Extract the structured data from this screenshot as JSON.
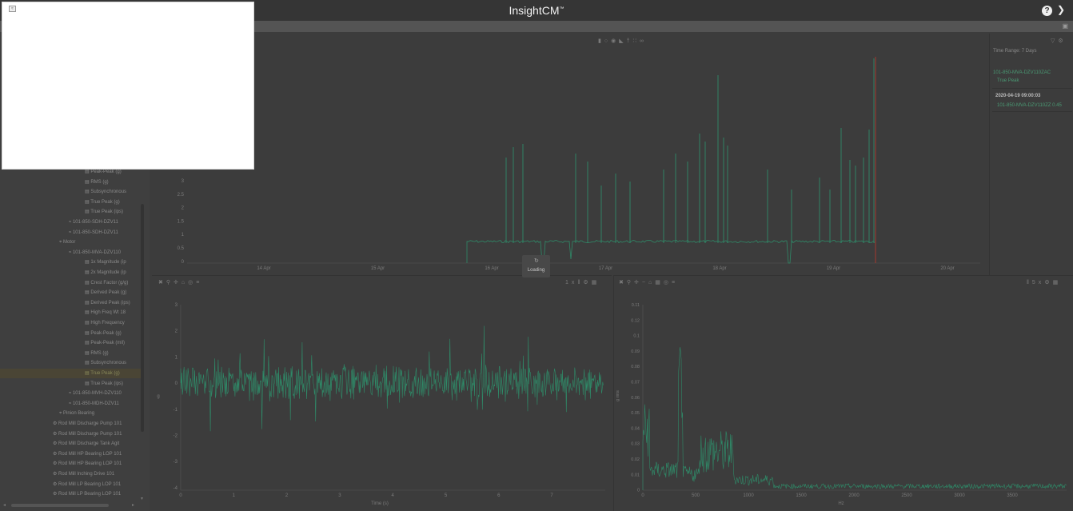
{
  "app": {
    "title": "InsightCM",
    "trademark": "™"
  },
  "header": {
    "help_icon": "question-circle-icon",
    "menu_icon": "chevron-down-icon"
  },
  "colors": {
    "trace": "#2f8a68",
    "marker": "#c0392b",
    "background": "#3c3c3c",
    "legend_text": "#4a9a74"
  },
  "sidebar": {
    "items": [
      {
        "label": "Peak-Peak (g)",
        "icon": "chart-icon",
        "level": 3
      },
      {
        "label": "RMS (g)",
        "icon": "chart-icon",
        "level": 3
      },
      {
        "label": "Subsynchronous",
        "icon": "chart-icon",
        "level": 3
      },
      {
        "label": "True Peak (g)",
        "icon": "chart-icon",
        "level": 3
      },
      {
        "label": "True Peak (ips)",
        "icon": "chart-icon",
        "level": 3
      },
      {
        "label": "101-850-SDH-DZV11",
        "icon": "sensor-icon",
        "level": 2
      },
      {
        "label": "101-850-SDH-DZV11",
        "icon": "sensor-icon",
        "level": 2
      },
      {
        "label": "Motor",
        "icon": "location-icon",
        "level": 1
      },
      {
        "label": "101-850-MVA-DZV110",
        "icon": "sensor-icon",
        "level": 2
      },
      {
        "label": "1x Magnitude (ip",
        "icon": "chart-icon",
        "level": 3
      },
      {
        "label": "2x Magnitude (ip",
        "icon": "chart-icon",
        "level": 3
      },
      {
        "label": "Crest Factor (g/g)",
        "icon": "chart-icon",
        "level": 3
      },
      {
        "label": "Derived Peak (g)",
        "icon": "chart-icon",
        "level": 3
      },
      {
        "label": "Derived Peak (ips)",
        "icon": "chart-icon",
        "level": 3
      },
      {
        "label": "High Freq Wt 18",
        "icon": "chart-icon",
        "level": 3
      },
      {
        "label": "High Frequency",
        "icon": "chart-icon",
        "level": 3
      },
      {
        "label": "Peak-Peak (g)",
        "icon": "chart-icon",
        "level": 3
      },
      {
        "label": "Peak-Peak (mil)",
        "icon": "chart-icon",
        "level": 3
      },
      {
        "label": "RMS (g)",
        "icon": "chart-icon",
        "level": 3
      },
      {
        "label": "Subsynchronous",
        "icon": "chart-icon",
        "level": 3
      },
      {
        "label": "True Peak (g)",
        "icon": "chart-icon",
        "level": 3,
        "selected": true
      },
      {
        "label": "True Peak (ips)",
        "icon": "chart-icon",
        "level": 3
      },
      {
        "label": "101-850-MVH-DZV110",
        "icon": "sensor-icon",
        "level": 2
      },
      {
        "label": "101-850-MDH-DZV11",
        "icon": "sensor-icon",
        "level": 2
      },
      {
        "label": "Pinion Bearing",
        "icon": "location-icon",
        "level": 1
      },
      {
        "label": "Rod Mill Discharge Pump 101",
        "icon": "asset-icon",
        "level": 0
      },
      {
        "label": "Rod Mill Discharge Pump 101",
        "icon": "asset-icon",
        "level": 0
      },
      {
        "label": "Rod Mill Discharge Tank Agit",
        "icon": "asset-icon",
        "level": 0
      },
      {
        "label": "Rod Mill HP Bearing LOP 101",
        "icon": "asset-icon",
        "level": 0
      },
      {
        "label": "Rod Mill HP Bearing LOP 101",
        "icon": "asset-icon",
        "level": 0
      },
      {
        "label": "Rod Mill Inching Drive 101",
        "icon": "asset-icon",
        "level": 0
      },
      {
        "label": "Rod Mill LP Bearing LOP 101",
        "icon": "asset-icon",
        "level": 0
      },
      {
        "label": "Rod Mill LP Bearing LOP 101",
        "icon": "asset-icon",
        "level": 0
      }
    ]
  },
  "trend_chart": {
    "toolbar_icons": [
      "trash-icon",
      "circle-icon",
      "record-icon",
      "rss-icon",
      "pin-icon",
      "dots-icon",
      "link-icon"
    ],
    "right_icons": [
      "filter-icon",
      "gear-icon"
    ],
    "y_ticks": [
      "3",
      "2.5",
      "2",
      "1.5",
      "1",
      "0.5",
      "0"
    ],
    "x_ticks": [
      "14 Apr",
      "15 Apr",
      "16 Apr",
      "17 Apr",
      "18 Apr",
      "19 Apr",
      "20 Apr"
    ]
  },
  "legend": {
    "time_range": "Time Range: 7 Days",
    "series_name": "101-850-MVA-DZV110ZAC",
    "series_measure": "True Peak",
    "timestamp": "2020-04-19 09:00:03",
    "value_line": "101-850-MVA-DZV110ZZ 0.45"
  },
  "loading": {
    "text": "Loading"
  },
  "waveform_chart": {
    "toolbar_left": [
      "cursor-icon",
      "zoom-icon",
      "pan-icon",
      "reset-icon",
      "camera-icon",
      "menu-icon"
    ],
    "toolbar_right": [
      "1x-label",
      "pause-icon",
      "gear-icon",
      "grid-icon"
    ],
    "toolbar_right_label": "1x",
    "y_ticks": [
      "3",
      "2",
      "1",
      "0",
      "-1",
      "-2",
      "-3",
      "-4"
    ],
    "x_ticks": [
      "0",
      "1",
      "2",
      "3",
      "4",
      "5",
      "6",
      "7"
    ],
    "xlabel": "Time (s)",
    "ylabel": "g"
  },
  "spectrum_chart": {
    "toolbar_left": [
      "cursor-icon",
      "zoom-icon",
      "pan-icon",
      "minus-icon",
      "reset-icon",
      "grid-icon",
      "camera-icon",
      "menu-icon"
    ],
    "toolbar_right": [
      "pause-icon",
      "1x-label",
      "gear-icon",
      "grid-icon"
    ],
    "toolbar_right_label": "5x",
    "y_ticks": [
      "0.11",
      "0.12",
      "0.1",
      "0.09",
      "0.08",
      "0.07",
      "0.06",
      "0.05",
      "0.04",
      "0.03",
      "0.02",
      "0.01",
      "0"
    ],
    "x_ticks": [
      "0",
      "500",
      "1000",
      "1500",
      "2000",
      "2500",
      "3000",
      "3500"
    ],
    "xlabel": "Hz",
    "ylabel": "g rms"
  }
}
